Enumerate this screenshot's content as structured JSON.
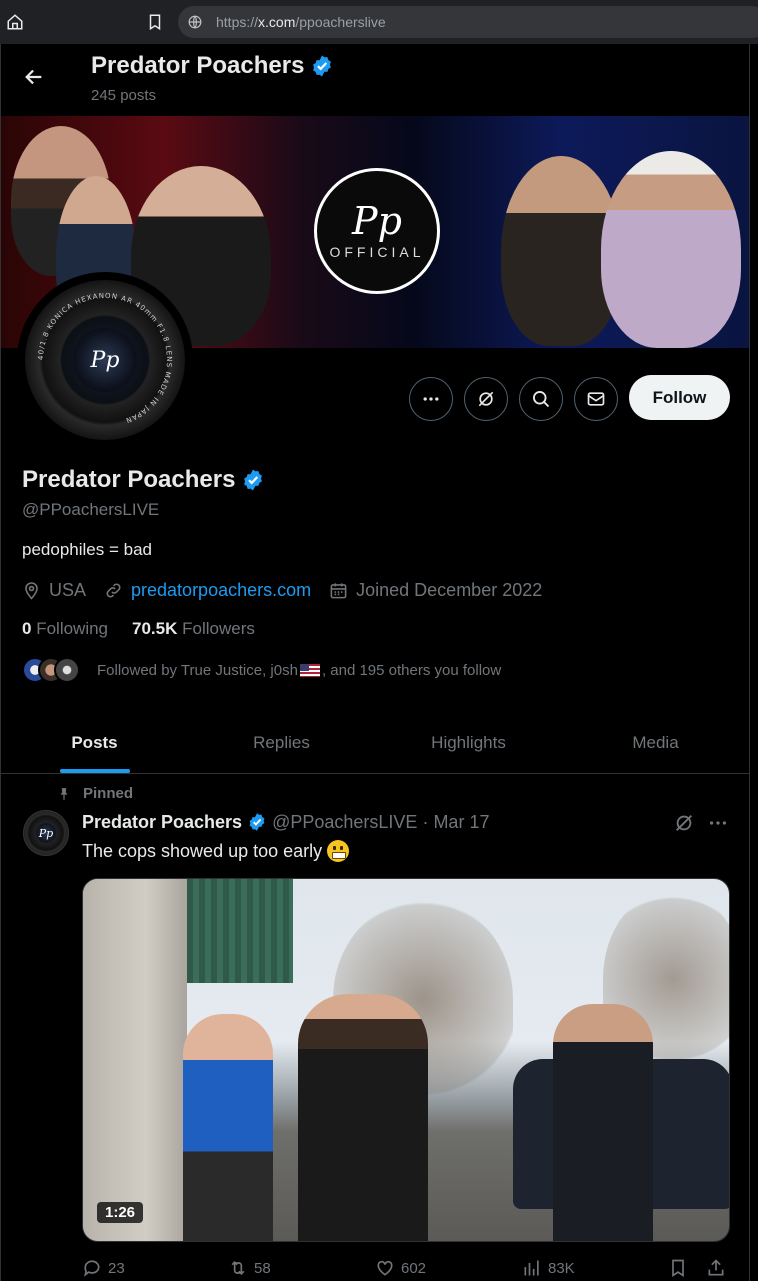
{
  "browser": {
    "url_prefix": "https://",
    "url_host": "x.com",
    "url_path": "/ppoacherslive"
  },
  "header": {
    "name": "Predator Poachers",
    "posts_count": "245 posts"
  },
  "banner": {
    "logo_text": "Pp",
    "logo_subtext": "OFFICIAL"
  },
  "avatar": {
    "logo_text": "Pp",
    "ring_text": "40/1.8 KONICA HEXANON AR 40mm F1.8 LENS MADE IN JAPAN"
  },
  "actions": {
    "follow_label": "Follow"
  },
  "profile": {
    "name": "Predator Poachers",
    "handle": "@PPoachersLIVE",
    "bio": "pedophiles = bad",
    "location": "USA",
    "website": "predatorpoachers.com",
    "joined": "Joined December 2022",
    "following_count": "0",
    "following_label": "Following",
    "followers_count": "70.5K",
    "followers_label": "Followers",
    "followed_by_prefix": "Followed by True Justice, j0sh",
    "followed_by_suffix": ", and 195 others you follow"
  },
  "tabs": [
    {
      "label": "Posts",
      "active": true
    },
    {
      "label": "Replies",
      "active": false
    },
    {
      "label": "Highlights",
      "active": false
    },
    {
      "label": "Media",
      "active": false
    }
  ],
  "tweet": {
    "pinned_label": "Pinned",
    "author_name": "Predator Poachers",
    "author_handle": "@PPoachersLIVE",
    "separator": "·",
    "date": "Mar 17",
    "text": "The cops showed up too early",
    "video_duration": "1:26",
    "replies": "23",
    "reposts": "58",
    "likes": "602",
    "views": "83K"
  },
  "colors": {
    "accent": "#1d9bf0",
    "background": "#000000",
    "muted": "#71767b",
    "text": "#e7e9ea"
  },
  "icons": [
    "home-icon",
    "bookmark-icon",
    "globe-icon",
    "back-arrow-icon",
    "verified-badge-icon",
    "more-icon",
    "grok-icon",
    "search-icon",
    "message-icon",
    "location-icon",
    "link-icon",
    "calendar-icon",
    "pin-icon",
    "reply-icon",
    "repost-icon",
    "like-icon",
    "views-icon",
    "share-icon"
  ]
}
